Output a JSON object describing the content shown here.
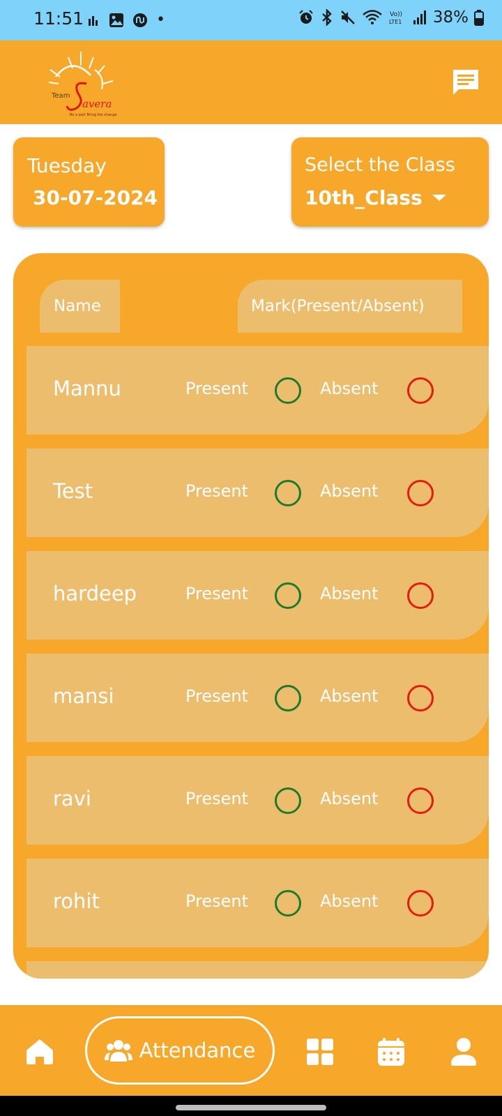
{
  "status_bar": {
    "time": "11:51",
    "dot": "•",
    "battery": "38%",
    "left_icons": [
      "activity-icon",
      "gallery-icon",
      "app-icon"
    ],
    "right_icons": [
      "alarm-icon",
      "bluetooth-icon",
      "mute-icon",
      "wifi-icon",
      "volte-icon",
      "signal-icon",
      "battery-icon"
    ]
  },
  "header": {
    "logo_icon": "team-savera-logo",
    "chat_icon": "chat-icon"
  },
  "date_card": {
    "day": "Tuesday",
    "date": "30-07-2024"
  },
  "class_selector": {
    "label": "Select the Class",
    "value": "10th_Class"
  },
  "table": {
    "name_header": "Name",
    "mark_header": "Mark(Present/Absent)",
    "present_label": "Present",
    "absent_label": "Absent",
    "students": [
      "Mannu",
      "Test",
      "hardeep",
      "mansi",
      "ravi",
      "rohit"
    ]
  },
  "bottom_nav": {
    "active_label": "Attendance",
    "items": [
      "home-icon",
      "attendance-icon",
      "grid-icon",
      "calendar-icon",
      "profile-icon"
    ]
  },
  "colors": {
    "primary": "#f7a82a",
    "row": "#ebbd6d",
    "status_bar": "#7fd3fb",
    "present": "#1b7a2b",
    "absent": "#e41b0e"
  }
}
